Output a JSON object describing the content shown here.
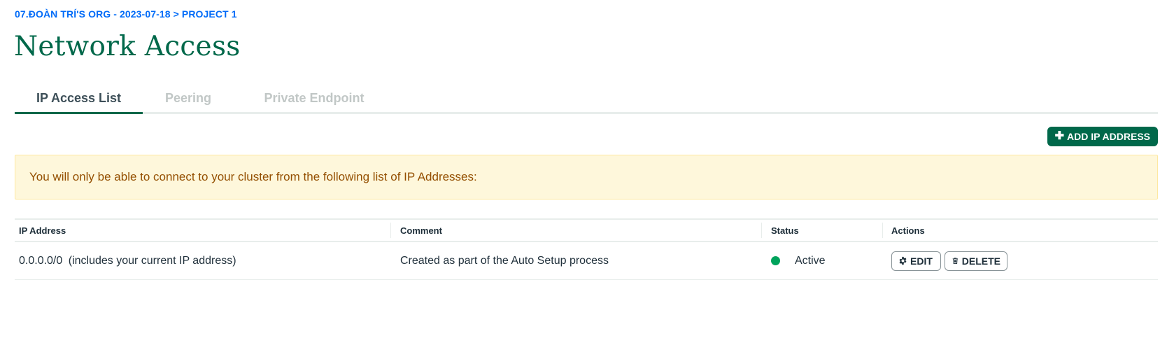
{
  "breadcrumb": "07.ĐOÀN TRÍ'S ORG - 2023-07-18 > PROJECT 1",
  "page_title": "Network Access",
  "tabs": [
    {
      "label": "IP Access List",
      "active": true
    },
    {
      "label": "Peering",
      "active": false
    },
    {
      "label": "Private Endpoint",
      "active": false
    }
  ],
  "toolbar": {
    "add_ip_label": "ADD IP ADDRESS",
    "add_ip_icon": "plus-icon"
  },
  "notice": {
    "text": "You will only be able to connect to your cluster from the following list of IP Addresses:"
  },
  "table": {
    "columns": [
      "IP Address",
      "Comment",
      "Status",
      "Actions"
    ],
    "rows": [
      {
        "ip": "0.0.0.0/0",
        "ip_note": "(includes your current IP address)",
        "comment": "Created as part of the Auto Setup process",
        "status": "Active",
        "status_color": "#00a35c",
        "edit_label": "EDIT",
        "edit_icon": "gear-icon",
        "delete_label": "DELETE",
        "delete_icon": "trash-icon"
      }
    ]
  },
  "colors": {
    "brand_green": "#00684a",
    "breadcrumb_blue": "#016bf8",
    "notice_bg": "#fef7db",
    "notice_text": "#944f01"
  }
}
